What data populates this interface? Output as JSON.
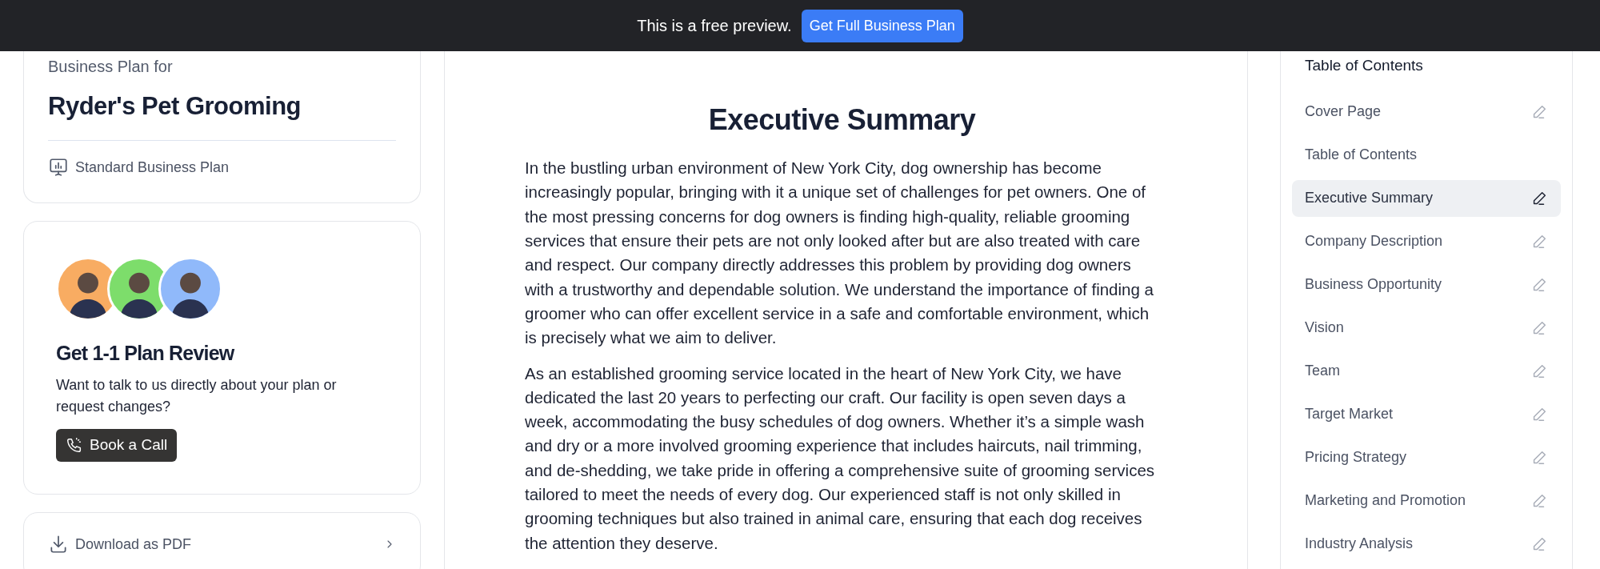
{
  "preview_bar": {
    "message": "This is a free preview.",
    "button": "Get Full Business Plan"
  },
  "plan_card": {
    "eyebrow": "Business Plan for",
    "title": "Ryder's Pet Grooming",
    "plan_type": "Standard Business Plan"
  },
  "review_card": {
    "avatars": [
      {
        "color": "#f8ac62"
      },
      {
        "color": "#7ddd6b"
      },
      {
        "color": "#90b9fa"
      }
    ],
    "title": "Get 1-1 Plan Review",
    "text": "Want to talk to us directly about your plan or request changes?",
    "button": "Book a Call"
  },
  "download_card": {
    "label": "Download as PDF"
  },
  "document": {
    "heading": "Executive Summary",
    "paragraphs": [
      "In the bustling urban environment of New York City, dog ownership has become increasingly popular, bringing with it a unique set of challenges for pet owners. One of the most pressing concerns for dog owners is finding high-quality, reliable grooming services that ensure their pets are not only looked after but are also treated with care and respect. Our company directly addresses this problem by providing dog owners with a trustworthy and dependable solution. We understand the importance of finding a groomer who can offer excellent service in a safe and comfortable environment, which is precisely what we aim to deliver.",
      "As an established grooming service located in the heart of New York City, we have dedicated the last 20 years to perfecting our craft. Our facility is open seven days a week, accommodating the busy schedules of dog owners. Whether it’s a simple wash and dry or a more involved grooming experience that includes haircuts, nail trimming, and de-shedding, we take pride in offering a comprehensive suite of grooming services tailored to meet the needs of every dog. Our experienced staff is not only skilled in grooming techniques but also trained in animal care, ensuring that each dog receives the attention they deserve."
    ]
  },
  "table_of_contents": {
    "title": "Table of Contents",
    "items": [
      {
        "label": "Cover Page",
        "selected": false,
        "editable": true
      },
      {
        "label": "Table of Contents",
        "selected": false,
        "editable": false
      },
      {
        "label": "Executive Summary",
        "selected": true,
        "editable": true
      },
      {
        "label": "Company Description",
        "selected": false,
        "editable": true
      },
      {
        "label": "Business Opportunity",
        "selected": false,
        "editable": true
      },
      {
        "label": "Vision",
        "selected": false,
        "editable": true
      },
      {
        "label": "Team",
        "selected": false,
        "editable": true
      },
      {
        "label": "Target Market",
        "selected": false,
        "editable": true
      },
      {
        "label": "Pricing Strategy",
        "selected": false,
        "editable": true
      },
      {
        "label": "Marketing and Promotion",
        "selected": false,
        "editable": true
      },
      {
        "label": "Industry Analysis",
        "selected": false,
        "editable": true
      }
    ]
  }
}
